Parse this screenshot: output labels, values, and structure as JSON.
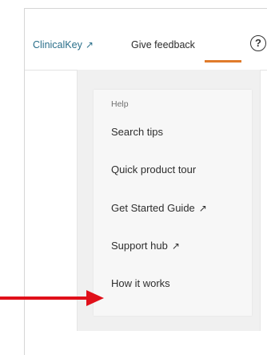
{
  "topbar": {
    "clinicalkey_label": "ClinicalKey",
    "external_glyph": "↗",
    "feedback_label": "Give feedback",
    "help_glyph": "?"
  },
  "help_menu": {
    "header": "Help",
    "items": [
      {
        "label": "Search tips",
        "external": ""
      },
      {
        "label": "Quick product tour",
        "external": ""
      },
      {
        "label": "Get Started Guide",
        "external": "↗"
      },
      {
        "label": "Support hub",
        "external": "↗"
      },
      {
        "label": "How it works",
        "external": ""
      }
    ]
  },
  "colors": {
    "link": "#2a6f8a",
    "accent_underline": "#e07b2b",
    "annotation_arrow": "#e0101a"
  },
  "icons": {
    "external": "external-link-icon",
    "help": "help-circle-icon",
    "annotation": "red-arrow-icon"
  }
}
